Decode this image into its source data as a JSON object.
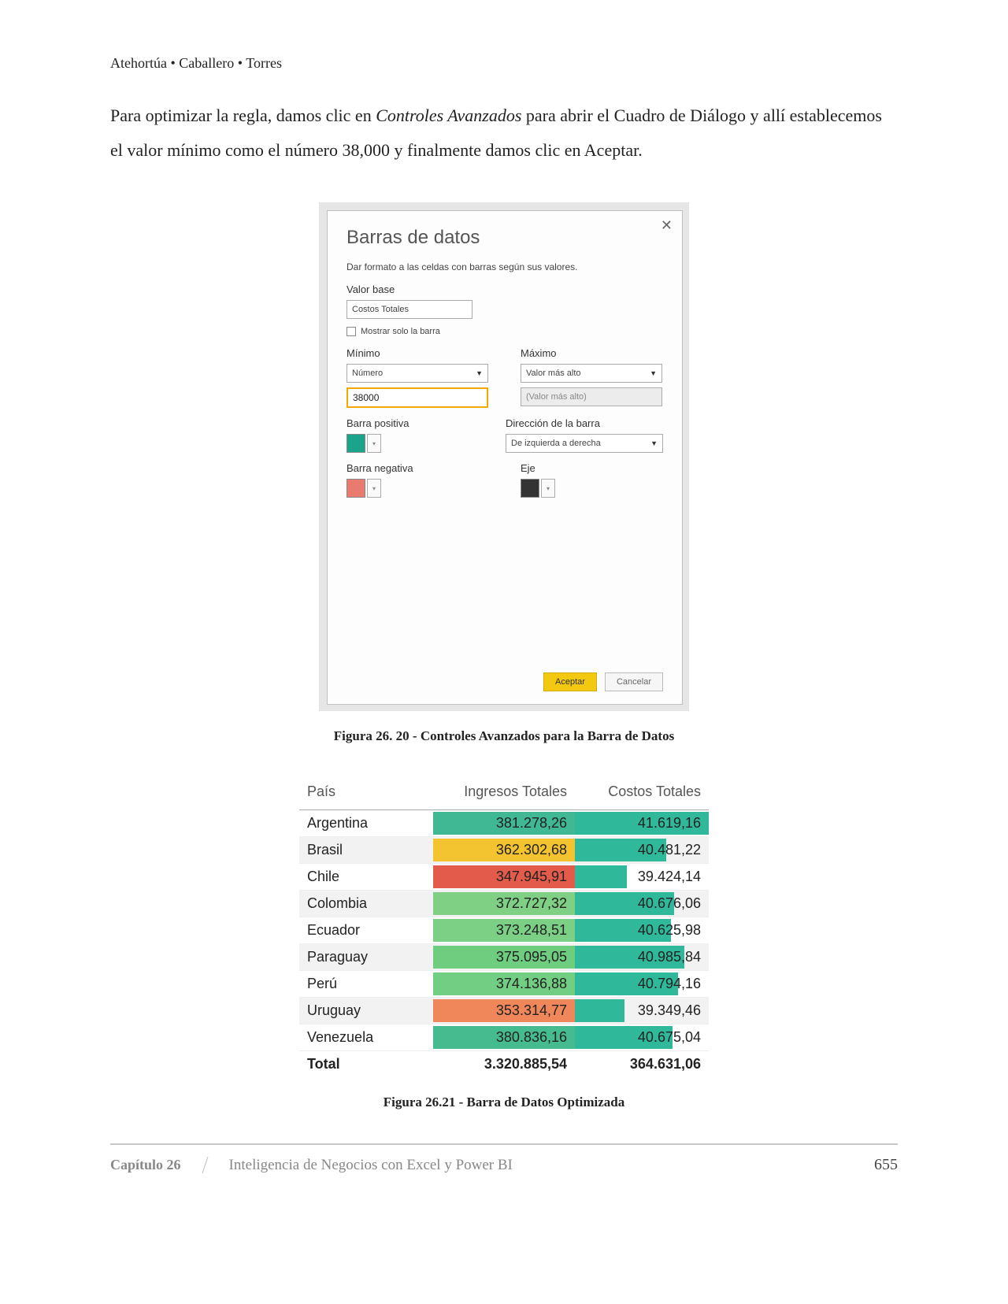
{
  "header": {
    "authors": "Atehortúa • Caballero • Torres"
  },
  "body": {
    "p1_a": "Para optimizar la regla, damos clic en ",
    "p1_i": "Controles Avanzados",
    "p1_b": " para abrir el Cuadro de Diálogo y allí establecemos el valor mínimo como el número 38,000 y finalmente damos clic en Aceptar."
  },
  "dialog": {
    "close": "✕",
    "title": "Barras de datos",
    "desc": "Dar formato a las celdas con barras según sus valores.",
    "base_label": "Valor base",
    "base_value": "Costos Totales",
    "show_bar_only": "Mostrar solo la barra",
    "min_label": "Mínimo",
    "max_label": "Máximo",
    "min_type": "Número",
    "max_type": "Valor más alto",
    "min_value": "38000",
    "max_placeholder": "(Valor más alto)",
    "pos_label": "Barra positiva",
    "dir_label": "Dirección de la barra",
    "dir_value": "De izquierda a derecha",
    "neg_label": "Barra negativa",
    "axis_label": "Eje",
    "accept": "Aceptar",
    "cancel": "Cancelar"
  },
  "fig20": "Figura 26. 20 - Controles Avanzados para la Barra de Datos",
  "table": {
    "h_country": "País",
    "h_income": "Ingresos Totales",
    "h_cost": "Costos Totales",
    "rows": [
      {
        "c": "Argentina",
        "i": "381.278,26",
        "t": "41.619,16",
        "ic": "#3fb893",
        "bp": 100
      },
      {
        "c": "Brasil",
        "i": "362.302,68",
        "t": "40.481,22",
        "ic": "#f4c430",
        "bp": 68
      },
      {
        "c": "Chile",
        "i": "347.945,91",
        "t": "39.424,14",
        "ic": "#e25b4b",
        "bp": 39
      },
      {
        "c": "Colombia",
        "i": "372.727,32",
        "t": "40.676,06",
        "ic": "#7fcf85",
        "bp": 74
      },
      {
        "c": "Ecuador",
        "i": "373.248,51",
        "t": "40.625,98",
        "ic": "#7bd085",
        "bp": 72
      },
      {
        "c": "Paraguay",
        "i": "375.095,05",
        "t": "40.985,84",
        "ic": "#6fcd80",
        "bp": 82
      },
      {
        "c": "Perú",
        "i": "374.136,88",
        "t": "40.794,16",
        "ic": "#72ce82",
        "bp": 77
      },
      {
        "c": "Uruguay",
        "i": "353.314,77",
        "t": "39.349,46",
        "ic": "#f0875a",
        "bp": 37
      },
      {
        "c": "Venezuela",
        "i": "380.836,16",
        "t": "40.675,04",
        "ic": "#47bb90",
        "bp": 73
      }
    ],
    "total_label": "Total",
    "total_income": "3.320.885,54",
    "total_cost": "364.631,06"
  },
  "fig21": "Figura 26.21 -  Barra de Datos Optimizada",
  "footer": {
    "chapter": "Capítulo 26",
    "title": "Inteligencia de Negocios con Excel y Power BI",
    "page": "655"
  },
  "colors": {
    "bar": "#2fb89a"
  },
  "chart_data": {
    "type": "table",
    "title": "Barra de Datos Optimizada",
    "columns": [
      "País",
      "Ingresos Totales",
      "Costos Totales"
    ],
    "series": [
      {
        "name": "Ingresos Totales",
        "values": [
          381278.26,
          362302.68,
          347945.91,
          372727.32,
          373248.51,
          375095.05,
          374136.88,
          353314.77,
          380836.16
        ]
      },
      {
        "name": "Costos Totales",
        "values": [
          41619.16,
          40481.22,
          39424.14,
          40676.06,
          40625.98,
          40985.84,
          40794.16,
          39349.46,
          40675.04
        ]
      }
    ],
    "categories": [
      "Argentina",
      "Brasil",
      "Chile",
      "Colombia",
      "Ecuador",
      "Paraguay",
      "Perú",
      "Uruguay",
      "Venezuela"
    ],
    "totals": {
      "Ingresos Totales": 3320885.54,
      "Costos Totales": 364631.06
    },
    "databar": {
      "field": "Costos Totales",
      "min": 38000,
      "max": 41619.16,
      "direction": "left-to-right"
    }
  }
}
